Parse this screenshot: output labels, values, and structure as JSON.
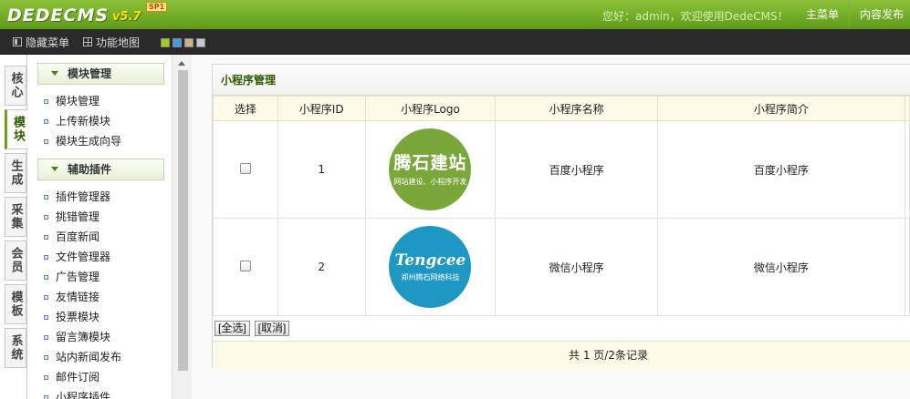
{
  "header": {
    "logo_text": "DEDECMS",
    "logo_version": "v5.7",
    "logo_badge": "SP1",
    "welcome": "您好：admin，欢迎使用DedeCMS！",
    "nav": [
      "主菜单",
      "内容发布"
    ]
  },
  "toolbar": {
    "hide_menu": "隐藏菜单",
    "site_map": "功能地图",
    "skin_colors": [
      "#9bd11a",
      "#3c9ee0",
      "#c9b28c",
      "#c8c8c8"
    ]
  },
  "left_tabs": [
    {
      "label": "核心",
      "active": false
    },
    {
      "label": "模块",
      "active": true
    },
    {
      "label": "生成",
      "active": false
    },
    {
      "label": "采集",
      "active": false
    },
    {
      "label": "会员",
      "active": false
    },
    {
      "label": "模板",
      "active": false
    },
    {
      "label": "系统",
      "active": false
    }
  ],
  "menu": {
    "section1": {
      "title": "模块管理",
      "items": [
        "模块管理",
        "上传新模块",
        "模块生成向导"
      ]
    },
    "section2": {
      "title": "辅助插件",
      "items": [
        "插件管理器",
        "挑错管理",
        "百度新闻",
        "文件管理器",
        "广告管理",
        "友情链接",
        "投票模块",
        "留言簿模块",
        "站内新闻发布",
        "邮件订阅",
        "小程序插件"
      ]
    }
  },
  "panel": {
    "title": "小程序管理",
    "columns": [
      "选择",
      "小程序ID",
      "小程序Logo",
      "小程序名称",
      "小程序简介"
    ],
    "rows": [
      {
        "id": "1",
        "logo_main": "腾石建站",
        "logo_sub": "网站建设、小程序开发",
        "logo_color": "#79a73a",
        "name": "百度小程序",
        "intro": "百度小程序"
      },
      {
        "id": "2",
        "logo_main": "Tengcee",
        "logo_sub": "郑州腾石网络科技",
        "logo_color": "#1e98c3",
        "name": "微信小程序",
        "intro": "微信小程序"
      }
    ],
    "select_all": "[全选]",
    "cancel": "[取消]",
    "pager": "共 1 页/2条记录"
  },
  "colors": {
    "header_green": "#6faa1f",
    "toolbar_dark": "#2a2a2a",
    "title_green": "#2d5a00",
    "table_head_bg": "#fbfbe7"
  }
}
